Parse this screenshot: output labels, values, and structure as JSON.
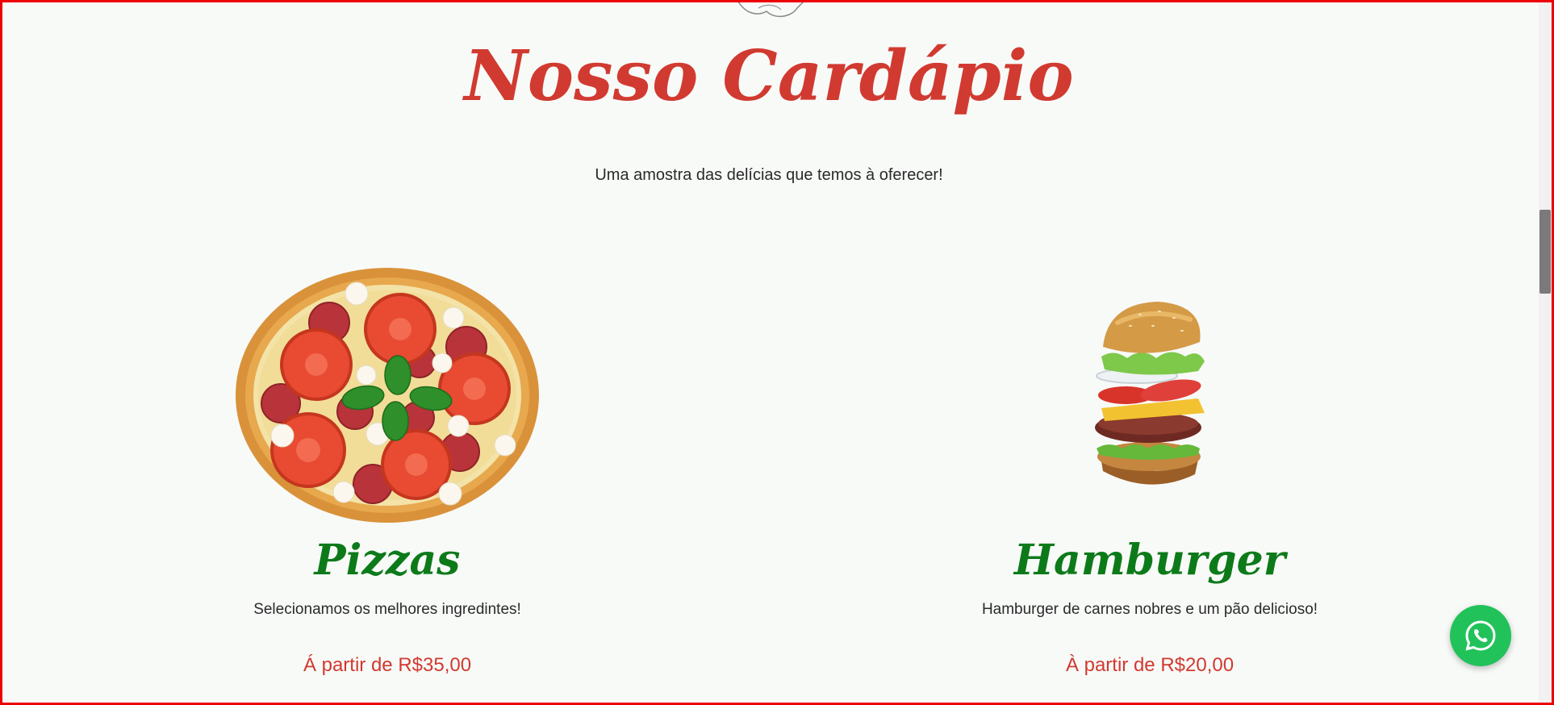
{
  "section": {
    "title": "Nosso Cardápio",
    "subtitle": "Uma amostra das delícias que temos à oferecer!"
  },
  "menu_items": [
    {
      "name": "Pizzas",
      "description": "Selecionamos os melhores ingredintes!",
      "price": "Á partir de R$35,00",
      "image": "pizza-image"
    },
    {
      "name": "Hamburger",
      "description": "Hamburger de carnes nobres e um pão delicioso!",
      "price": "À partir de R$20,00",
      "image": "hamburger-image"
    }
  ],
  "floating_action": {
    "icon": "whatsapp-icon"
  },
  "colors": {
    "title": "#d13a30",
    "item_title": "#0d7a1a",
    "price": "#d13a30",
    "whatsapp": "#22c25a",
    "background": "#f8faf8"
  }
}
